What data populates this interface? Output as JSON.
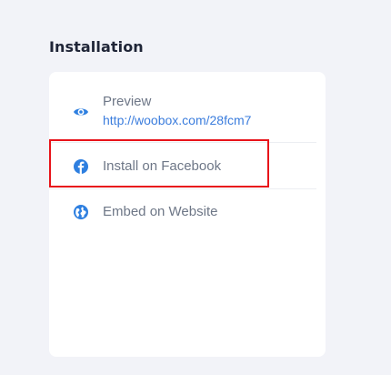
{
  "section": {
    "title": "Installation"
  },
  "items": [
    {
      "label": "Preview",
      "link": "http://woobox.com/28fcm7",
      "icon": "eye-icon"
    },
    {
      "label": "Install on Facebook",
      "icon": "facebook-icon"
    },
    {
      "label": "Embed on Website",
      "icon": "globe-icon"
    }
  ],
  "colors": {
    "accent": "#2e7fe0",
    "highlight_border": "#e8131a",
    "background": "#f2f3f8"
  }
}
